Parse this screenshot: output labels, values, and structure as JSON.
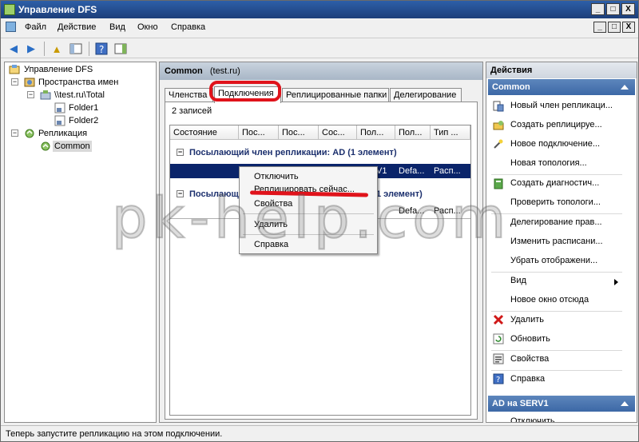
{
  "window": {
    "title": "Управление DFS",
    "buttons": {
      "minimize": "_",
      "maximize": "□",
      "close": "X"
    }
  },
  "menu": {
    "file": "Файл",
    "action": "Действие",
    "view": "Вид",
    "window": "Окно",
    "help": "Справка"
  },
  "tree": {
    "root": "Управление DFS",
    "namespaces": "Пространства имен",
    "namespace_root": "\\\\test.ru\\Total",
    "folder1": "Folder1",
    "folder2": "Folder2",
    "replication": "Репликация",
    "common": "Common"
  },
  "middle": {
    "header_name": "Common",
    "header_domain": "(test.ru)",
    "tabs": [
      "Членства",
      "Подключения",
      "Реплицированные папки",
      "Делегирование"
    ],
    "record_count": "2 записей",
    "columns": [
      "Состояние",
      "Пос...",
      "Пос...",
      "Сос...",
      "Пол...",
      "Пол...",
      "Тип ..."
    ],
    "group1": "Посылающий член репликации: AD (1 элемент)",
    "row1": {
      "c5": "V1",
      "c6": "Defa...",
      "c7": "Расп..."
    },
    "group2_start": "Посылающи",
    "group2_end": "1 элемент)",
    "row2": {
      "c6": "Defa...",
      "c7": "Расп..."
    }
  },
  "context_menu": {
    "items": [
      "Отключить",
      "Реплицировать сейчас...",
      "Свойства",
      "Удалить",
      "Справка"
    ]
  },
  "actions": {
    "header": "Действия",
    "section1": "Common",
    "items": [
      "Новый член репликаци...",
      "Создать реплицируе...",
      "Новое подключение...",
      "Новая топология...",
      "Создать диагностич...",
      "Проверить топологи...",
      "Делегирование прав...",
      "Изменить расписани...",
      "Убрать отображени...",
      "Вид",
      "Новое окно отсюда",
      "Удалить",
      "Обновить",
      "Свойства",
      "Справка"
    ],
    "section2": "AD на SERV1",
    "section2_first": "Отключить"
  },
  "status": "Теперь запустите репликацию на этом подключении.",
  "watermark": "pk-help.com",
  "colors": {
    "title_bar": "#1d3f7a",
    "selection": "#0a246a",
    "section_header": "#3c68a6",
    "annotation_red": "#e0131b"
  }
}
